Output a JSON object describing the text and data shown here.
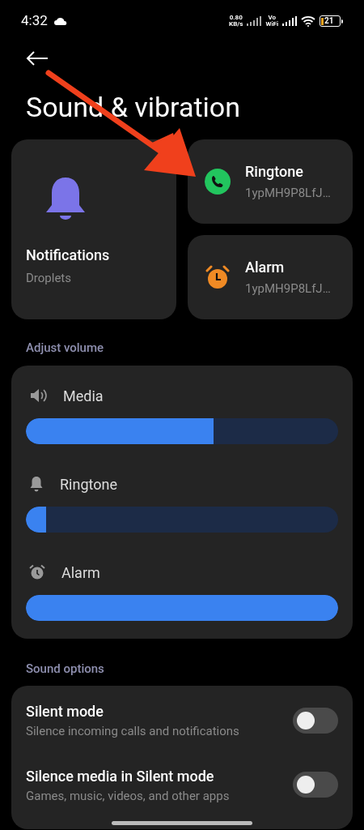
{
  "status_bar": {
    "time": "4:32",
    "speed_value": "0.80",
    "speed_unit": "KB/s",
    "vo": "Vo",
    "wifi": "WiFi",
    "battery": "21"
  },
  "title": "Sound & vibration",
  "notifications_card": {
    "title": "Notifications",
    "subtitle": "Droplets"
  },
  "sound_cards": [
    {
      "kind": "phone",
      "title": "Ringtone",
      "subtitle": "1ypMH9P8LfJ…",
      "color": "#22c55e"
    },
    {
      "kind": "alarm",
      "title": "Alarm",
      "subtitle": "1ypMH9P8LfJ…",
      "color": "#f08a24"
    }
  ],
  "volume_header": "Adjust volume",
  "volumes": [
    {
      "kind": "speaker",
      "name": "Media",
      "level": 0.6
    },
    {
      "kind": "bell",
      "name": "Ringtone",
      "level": 0.065
    },
    {
      "kind": "alarm",
      "name": "Alarm",
      "level": 1
    }
  ],
  "options_header": "Sound options",
  "options": [
    {
      "title": "Silent mode",
      "subtitle": "Silence incoming calls and notifications",
      "on": false
    },
    {
      "title": "Silence media in Silent mode",
      "subtitle": "Games, music, videos, and other apps",
      "on": false
    }
  ]
}
